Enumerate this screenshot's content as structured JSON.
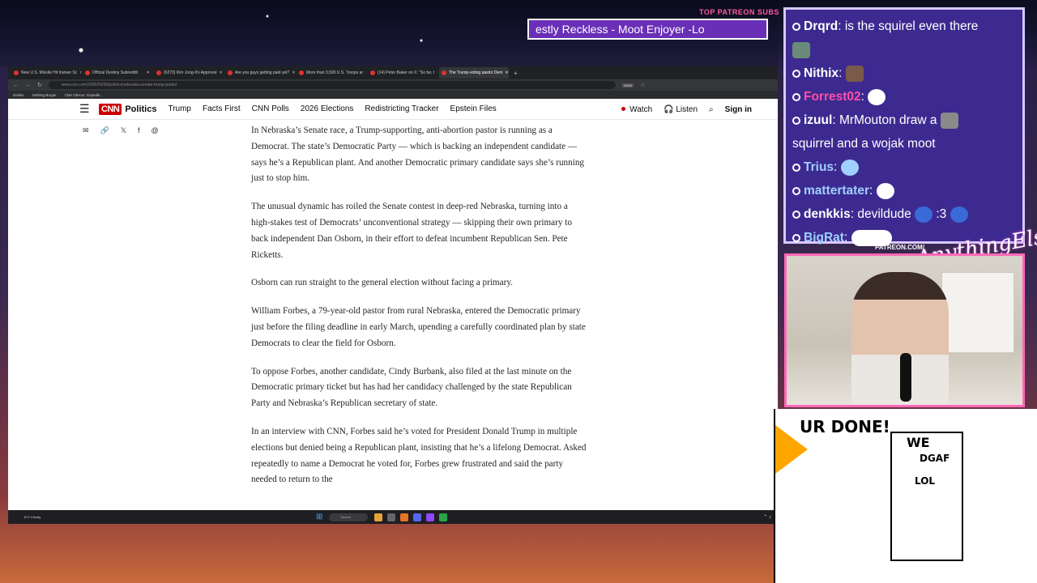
{
  "overlay": {
    "top_label": "TOP PATREON SUBS",
    "ticker": "estly Reckless - Moot Enjoyer -Lo",
    "patreon_label": "PATREON.COM/",
    "signature": "AnythingElse"
  },
  "browser": {
    "tabs": [
      {
        "label": "New U.S. Missile Hit Iranian Sc"
      },
      {
        "label": "Official Destiny Subreddit"
      },
      {
        "label": "(6273) Kim Jong-It's Approval"
      },
      {
        "label": "Are you guys getting paid yet?"
      },
      {
        "label": "More than 3,500 U.S. Troops ar"
      },
      {
        "label": "(14) Peter Baker on X: \"So far, t"
      },
      {
        "label": "The Trump-voting pastor Dem"
      }
    ],
    "url": "www.cnn.com/2026/03/30/politics/nebraska-senate-trump-pastor",
    "zoom": "160%",
    "bookmarks": [
      "Dailies",
      "Nothing Burger",
      "Clair Obscur: Expediti..."
    ]
  },
  "cnn": {
    "logo": "CNN",
    "section": "Politics",
    "nav": [
      "Trump",
      "Facts First",
      "CNN Polls",
      "2026 Elections",
      "Redistricting Tracker",
      "Epstein Files"
    ],
    "watch": "Watch",
    "listen": "Listen",
    "signin": "Sign in"
  },
  "article": {
    "paragraphs": [
      "In Nebraska’s Senate race, a Trump-supporting, anti-abortion pastor is running as a Democrat. The state’s Democratic Party — which is backing an independent candidate — says he’s a Republican plant. And another Democratic primary candidate says she’s running just to stop him.",
      "The unusual dynamic has roiled the Senate contest in deep-red Nebraska, turning into a high-stakes test of Democrats’ unconventional strategy — skipping their own primary to back independent Dan Osborn, in their effort to defeat incumbent Republican Sen. Pete Ricketts.",
      "Osborn can run straight to the general election without facing a primary.",
      "William Forbes, a 79-year-old pastor from rural Nebraska, entered the Democratic primary just before the filing deadline in early March, upending a carefully coordinated plan by state Democrats to clear the field for Osborn.",
      "To oppose Forbes, another candidate, Cindy Burbank, also filed at the last minute on the Democratic primary ticket but has had her candidacy challenged by the state Republican Party and Nebraska’s Republican secretary of state.",
      "In an interview with CNN, Forbes said he’s voted for President Donald Trump in multiple elections but denied being a Republican plant, insisting that he’s a lifelong Democrat. Asked repeatedly to name a Democrat he voted for, Forbes grew frustrated and said the party needed to return to the"
    ]
  },
  "taskbar": {
    "weather": "8°C Cloudy",
    "search": "Search"
  },
  "chat": {
    "messages": [
      {
        "user": "Drqrd",
        "text": "is the squirel even there",
        "color": "#ffffff"
      },
      {
        "user": "Nithix",
        "text": "",
        "color": "#ffffff"
      },
      {
        "user": "Forrest02",
        "text": "",
        "color": "#ff4fa8"
      },
      {
        "user": "izuul",
        "text": "MrMouton draw a",
        "text2": "squirrel and a wojak moot",
        "color": "#ffffff"
      },
      {
        "user": "Trius",
        "text": "",
        "color": "#9fd0ff"
      },
      {
        "user": "mattertater",
        "text": "",
        "color": "#9fd0ff"
      },
      {
        "user": "denkkis",
        "text": "devildude",
        "suffix": ":3",
        "color": "#ffffff"
      },
      {
        "user": "BigRat",
        "text": "",
        "color": "#9fd0ff"
      }
    ]
  },
  "comic": {
    "text1": "UR DONE!",
    "text2": "WE",
    "text3": "DGAF",
    "text4": "LOL"
  },
  "colors": {
    "chat_bg": "#3d2a90",
    "cnn_red": "#cc0000",
    "cam_border": "#ff6ab7"
  }
}
